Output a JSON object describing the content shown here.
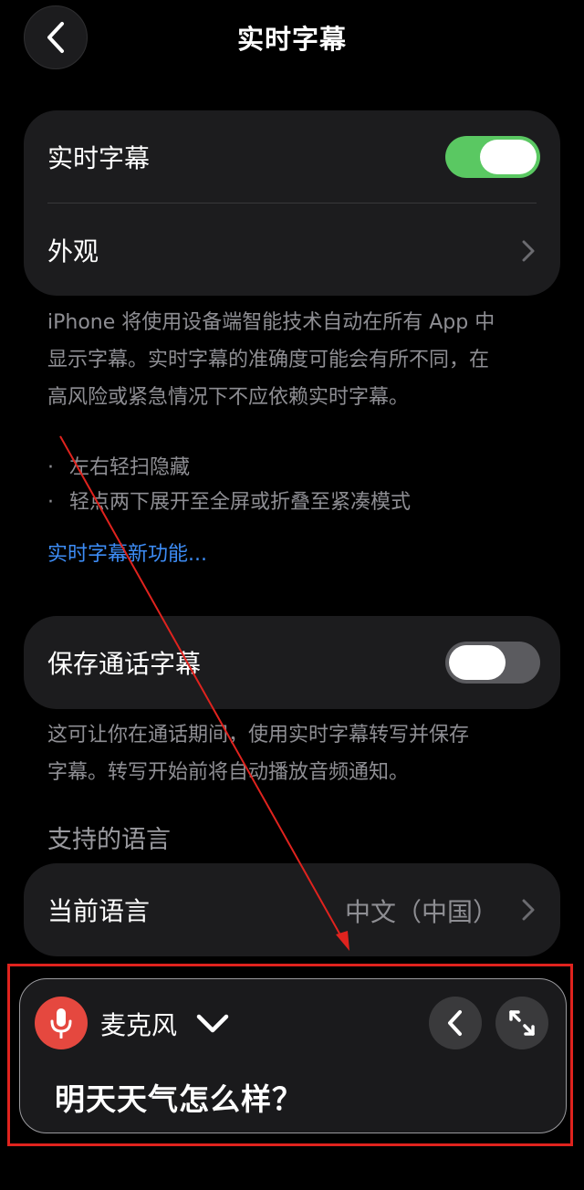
{
  "header": {
    "title": "实时字幕"
  },
  "settings": {
    "live_captions_label": "实时字幕",
    "live_captions_on": true,
    "appearance_label": "外观",
    "description": [
      "iPhone 将使用设备端智能技术自动在所有 App 中",
      "显示字幕。实时字幕的准确度可能会有所不同，在",
      "高风险或紧急情况下不应依赖实时字幕。"
    ],
    "bullets": [
      "左右轻扫隐藏",
      "轻点两下展开至全屏或折叠至紧凑模式"
    ],
    "bullet_symbol": "·",
    "whats_new_link": "实时字幕新功能..."
  },
  "call_captions": {
    "label": "保存通话字幕",
    "on": false,
    "description": [
      "这可让你在通话期间，使用实时字幕转写并保存",
      "字幕。转写开始前将自动播放音频通知。"
    ]
  },
  "languages": {
    "section_header": "支持的语言",
    "current_label": "当前语言",
    "current_value": "中文（中国）"
  },
  "caption_panel": {
    "source_label": "麦克风",
    "caption_text": "明天天气怎么样？",
    "icons": [
      "microphone-icon",
      "chevron-down-icon",
      "chevron-left-icon",
      "expand-icon"
    ]
  },
  "colors": {
    "background": "#000000",
    "card": "#1c1c1e",
    "toggle_on": "#5ac862",
    "toggle_off": "#5b5b5f",
    "link": "#3d8cf5",
    "mic": "#e5483f",
    "annotation": "#e0231e"
  }
}
